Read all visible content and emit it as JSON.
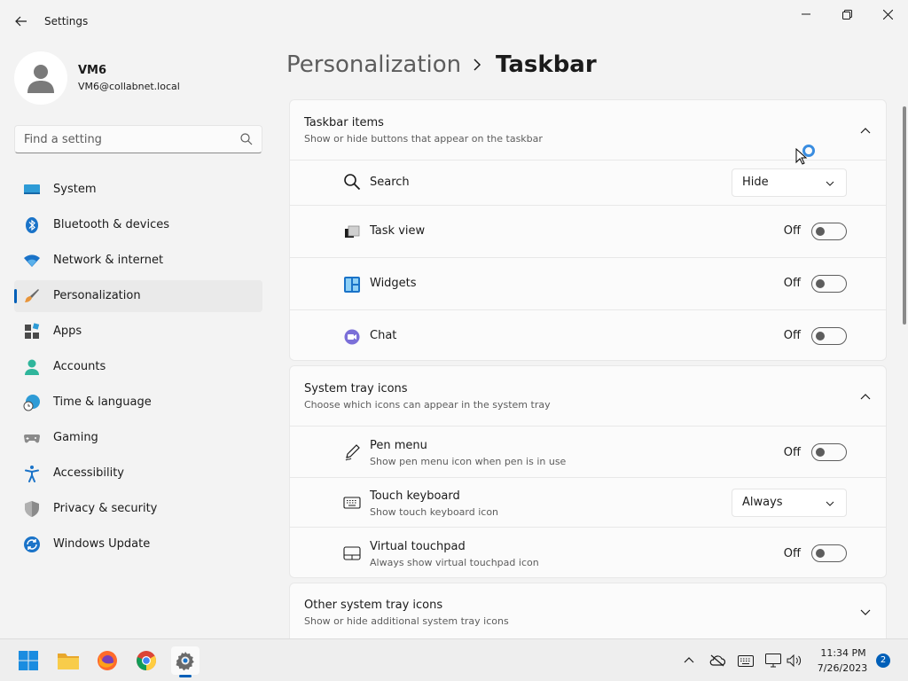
{
  "window": {
    "title": "Settings"
  },
  "user": {
    "name": "VM6",
    "email": "VM6@collabnet.local"
  },
  "search": {
    "placeholder": "Find a setting"
  },
  "nav": {
    "items": [
      {
        "label": "System"
      },
      {
        "label": "Bluetooth & devices"
      },
      {
        "label": "Network & internet"
      },
      {
        "label": "Personalization"
      },
      {
        "label": "Apps"
      },
      {
        "label": "Accounts"
      },
      {
        "label": "Time & language"
      },
      {
        "label": "Gaming"
      },
      {
        "label": "Accessibility"
      },
      {
        "label": "Privacy & security"
      },
      {
        "label": "Windows Update"
      }
    ]
  },
  "breadcrumb": {
    "parent": "Personalization",
    "current": "Taskbar"
  },
  "taskbar_items": {
    "title": "Taskbar items",
    "subtitle": "Show or hide buttons that appear on the taskbar",
    "search": {
      "label": "Search",
      "value": "Hide"
    },
    "task_view": {
      "label": "Task view",
      "state": "Off"
    },
    "widgets": {
      "label": "Widgets",
      "state": "Off"
    },
    "chat": {
      "label": "Chat",
      "state": "Off"
    }
  },
  "system_tray": {
    "title": "System tray icons",
    "subtitle": "Choose which icons can appear in the system tray",
    "pen_menu": {
      "label": "Pen menu",
      "sub": "Show pen menu icon when pen is in use",
      "state": "Off"
    },
    "touch_keyboard": {
      "label": "Touch keyboard",
      "sub": "Show touch keyboard icon",
      "value": "Always"
    },
    "virtual_touchpad": {
      "label": "Virtual touchpad",
      "sub": "Always show virtual touchpad icon",
      "state": "Off"
    }
  },
  "other_tray": {
    "title": "Other system tray icons",
    "subtitle": "Show or hide additional system tray icons"
  },
  "clock": {
    "time": "11:34 PM",
    "date": "7/26/2023"
  },
  "notifications": {
    "count": "2"
  },
  "colors": {
    "accent": "#005fb8",
    "background": "#f3f3f3",
    "card": "#fbfbfb"
  }
}
